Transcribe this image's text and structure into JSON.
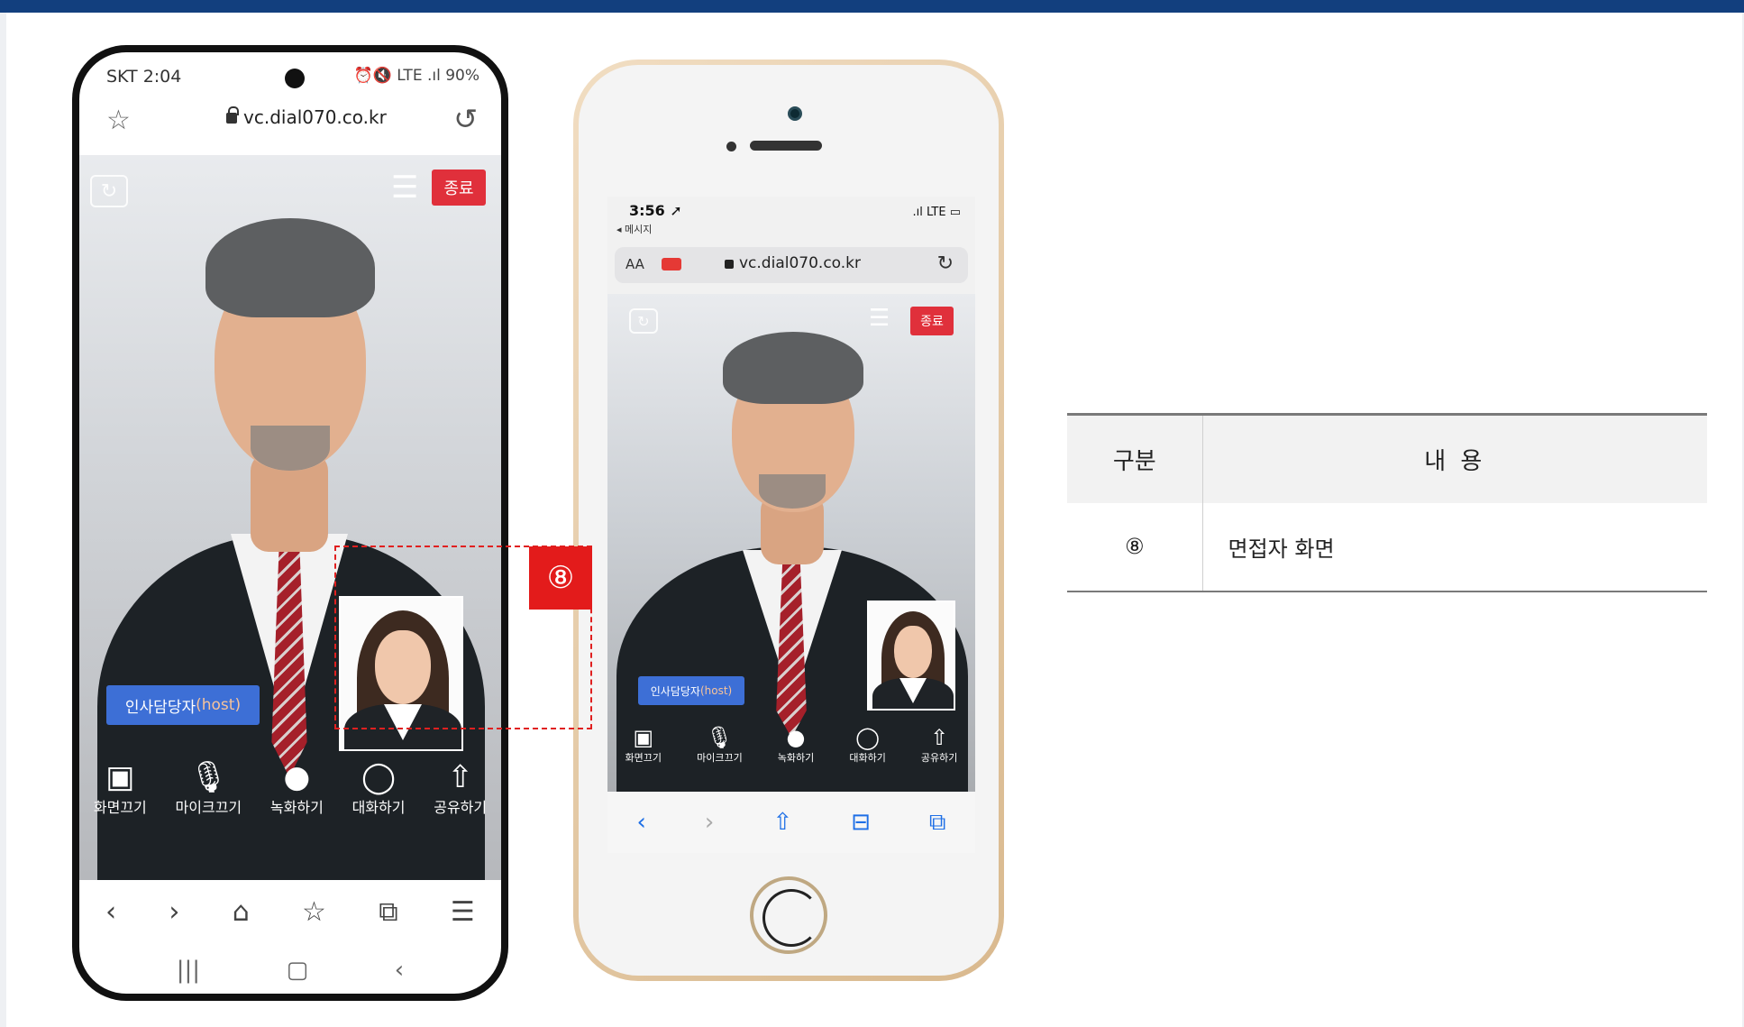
{
  "colors": {
    "brand_bar": "#123f7e",
    "end_button": "#e0303b",
    "host_tag": "#3d6fd6",
    "callout": "#e31b1b"
  },
  "android": {
    "status": {
      "time": "SKT 2:04",
      "icons": "⏰🔇 LTE .ıl 90%"
    },
    "url_bar": {
      "star_icon": "☆",
      "url": "vc.dial070.co.kr",
      "reload_icon": "↺"
    },
    "video": {
      "end_button": "종료",
      "host_tag_name": "인사담당자",
      "host_tag_role": "(host)",
      "controls": [
        {
          "icon": "camera-off-icon",
          "glyph": "▣",
          "label": "화면끄기"
        },
        {
          "icon": "mic-off-icon",
          "glyph": "🎙",
          "label": "마이크끄기"
        },
        {
          "icon": "record-icon",
          "glyph": "●",
          "label": "녹화하기"
        },
        {
          "icon": "chat-icon",
          "glyph": "◯",
          "label": "대화하기"
        },
        {
          "icon": "share-icon",
          "glyph": "⇧",
          "label": "공유하기"
        }
      ]
    },
    "browser_nav": [
      "‹",
      "›",
      "⌂",
      "☆",
      "⧉",
      "☰"
    ],
    "system_nav": [
      "|||",
      "▢",
      "‹"
    ]
  },
  "iphone": {
    "status": {
      "time": "3:56 ➚",
      "back": "◂ 메시지",
      "signal": ".ıl LTE ▭"
    },
    "url_bar": {
      "aa": "AA",
      "url": "vc.dial070.co.kr",
      "reload_icon": "↻"
    },
    "video": {
      "end_button": "종료",
      "host_tag_name": "인사담당자",
      "host_tag_role": "(host)",
      "controls": [
        {
          "icon": "camera-off-icon",
          "glyph": "▣",
          "label": "화면끄기"
        },
        {
          "icon": "mic-off-icon",
          "glyph": "🎙",
          "label": "마이크끄기"
        },
        {
          "icon": "record-icon",
          "glyph": "●",
          "label": "녹화하기"
        },
        {
          "icon": "chat-icon",
          "glyph": "◯",
          "label": "대화하기"
        },
        {
          "icon": "share-icon",
          "glyph": "⇧",
          "label": "공유하기"
        }
      ]
    },
    "toolbar": [
      "‹",
      "›",
      "⇧",
      "⊟",
      "⧉"
    ]
  },
  "callout": {
    "marker": "⑧"
  },
  "legend_table": {
    "headers": [
      "구분",
      "내 용"
    ],
    "rows": [
      {
        "key": "⑧",
        "value": "면접자 화면"
      }
    ]
  }
}
